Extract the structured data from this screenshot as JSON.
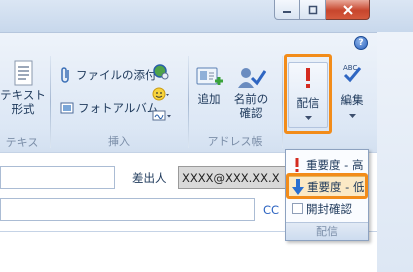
{
  "titlebar": {
    "controls": [
      "minimize-icon",
      "maximize-icon",
      "close-icon"
    ]
  },
  "ribbon": {
    "help_icon": "help-icon",
    "text_group": {
      "format_button": {
        "line1": "テキスト",
        "line2": "形式"
      },
      "group_label": "テキスト..."
    },
    "insert_group": {
      "attach_file": "ファイルの添付",
      "photo_album": "フォトアルバム",
      "group_label": "挿入"
    },
    "address_group": {
      "add_button": "追加",
      "check_names": {
        "line1": "名前の",
        "line2": "確認"
      },
      "group_label": "アドレス帳"
    },
    "delivery_button": {
      "label": "配信"
    },
    "edit_button": {
      "label": "編集"
    }
  },
  "compose": {
    "from_label": "差出人",
    "from_value": "XXXX@XXX.XX.X",
    "cc_label": "CC"
  },
  "delivery_menu": {
    "items": [
      {
        "label": "重要度 - 高",
        "icon": "exclamation-icon"
      },
      {
        "label": "重要度 - 低",
        "icon": "down-arrow-icon"
      },
      {
        "label": "開封確認",
        "icon": "checkbox-icon"
      }
    ],
    "footer": "配信"
  },
  "colors": {
    "highlight": "#f28c1a",
    "ribbon_bg": "#dce7f5",
    "text": "#1e395b"
  }
}
